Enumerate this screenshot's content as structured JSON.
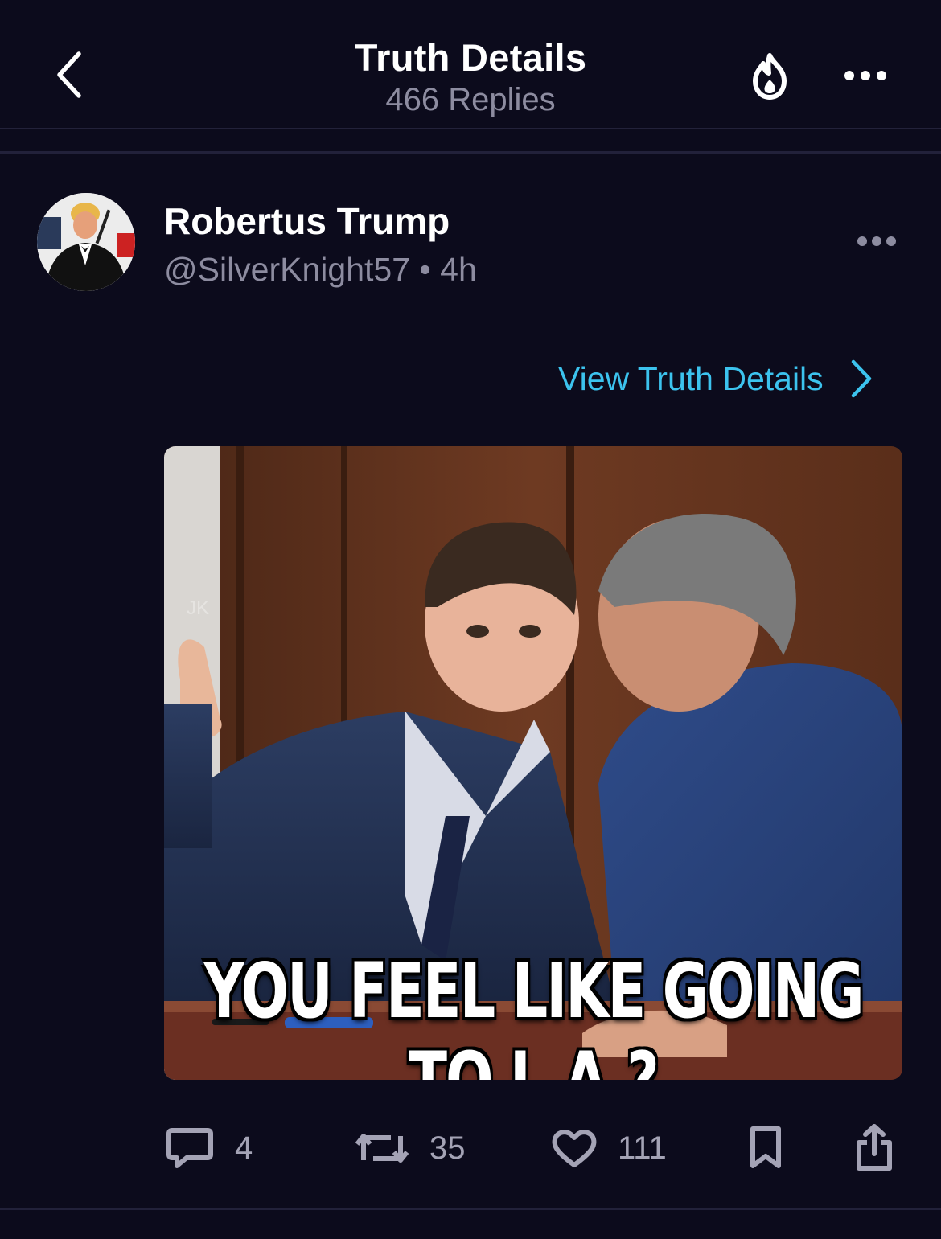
{
  "header": {
    "title": "Truth Details",
    "subtitle": "466 Replies",
    "back_icon": "chevron-left-icon",
    "fire_icon": "fire-icon",
    "more_icon": "more-horizontal-icon"
  },
  "post": {
    "author_name": "Robertus Trump",
    "author_handle": "@SilverKnight57",
    "separator": "•",
    "time": "4h",
    "view_details_label": "View Truth Details",
    "media": {
      "caption": "YOU FEEL LIKE GOING TO L.A.?",
      "watermark": "JK"
    }
  },
  "actions": {
    "replies": "4",
    "reposts": "35",
    "likes": "111"
  },
  "colors": {
    "background": "#0c0b1c",
    "accent": "#3cc3ee",
    "muted_text": "#8d8ca0",
    "icon": "#a4a3b5"
  }
}
